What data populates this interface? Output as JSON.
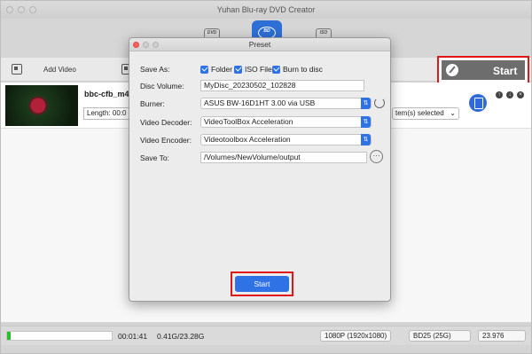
{
  "app": {
    "title": "Yuhan Blu-ray DVD Creator"
  },
  "modes": [
    {
      "icon": "dvd-icon",
      "glyph": "DVD"
    },
    {
      "icon": "bluray-icon",
      "glyph": "BD"
    },
    {
      "icon": "disc-copy-icon",
      "glyph": "ISO"
    }
  ],
  "toolbar": {
    "add_video": "Add Video",
    "start": "Start"
  },
  "file": {
    "name": "bbc-cfb_m48",
    "length_label": "Length: 00:0",
    "selection": "tem(s) selected"
  },
  "status": {
    "duration": "00:01:41",
    "size": "0.41G/23.28G",
    "progress_fraction": 0.03,
    "resolution": "1080P (1920x1080)",
    "disc_type": "BD25 (25G)",
    "framerate": "23.976"
  },
  "dialog": {
    "title": "Preset",
    "save_as_label": "Save As:",
    "save_as_options": {
      "folder": "Folder",
      "iso": "ISO File",
      "burn": "Burn to disc"
    },
    "disc_volume_label": "Disc Volume:",
    "disc_volume_value": "MyDisc_20230502_102828",
    "burner_label": "Burner:",
    "burner_value": "ASUS BW-16D1HT 3.00 via USB",
    "video_decoder_label": "Video Decoder:",
    "video_decoder_value": "VideoToolBox Acceleration",
    "video_encoder_label": "Video Encoder:",
    "video_encoder_value": "Videotoolbox Acceleration",
    "save_to_label": "Save To:",
    "save_to_value": "/Volumes/NewVolume/output",
    "browse": "···",
    "start": "Start"
  },
  "colors": {
    "accent": "#2f72e6",
    "highlight": "#e01818",
    "progress": "#27c227"
  }
}
